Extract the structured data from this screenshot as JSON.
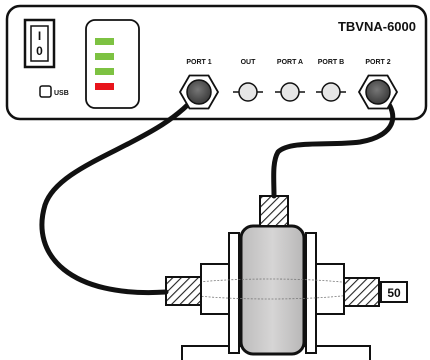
{
  "instrument": {
    "model": "TBVNA-6000",
    "power_switch": {
      "on": "I",
      "off": "0"
    },
    "usb_label": "USB",
    "status_leds": [
      {
        "color": "#7dc242"
      },
      {
        "color": "#7dc242"
      },
      {
        "color": "#7dc242"
      },
      {
        "color": "#e8141b"
      }
    ],
    "ports": [
      {
        "label": "PORT 1",
        "type": "cabled"
      },
      {
        "label": "OUT",
        "type": "open"
      },
      {
        "label": "PORT A",
        "type": "open"
      },
      {
        "label": "PORT B",
        "type": "open"
      },
      {
        "label": "PORT 2",
        "type": "cabled"
      }
    ]
  },
  "fixture": {
    "termination_label": "50"
  }
}
